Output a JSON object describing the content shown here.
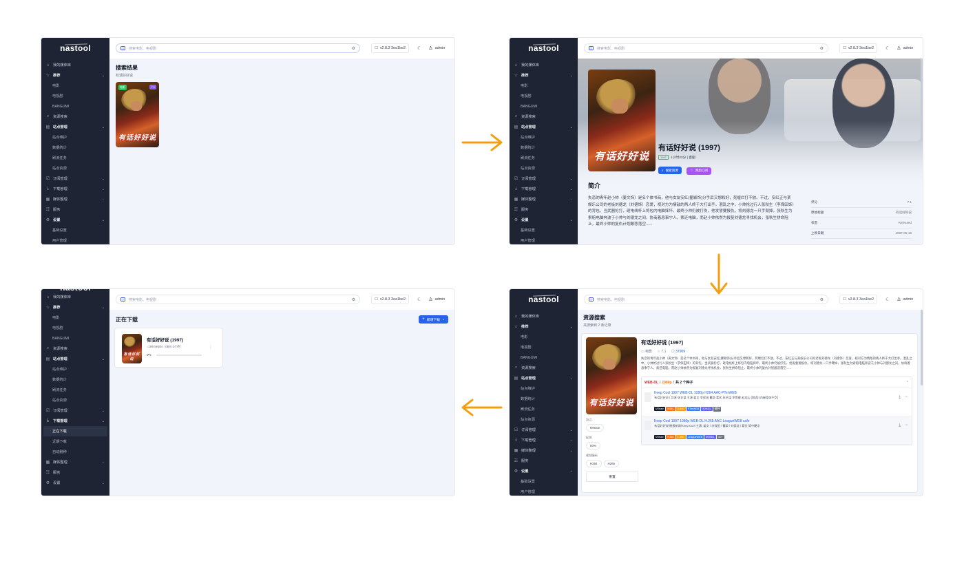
{
  "app": {
    "logo": "nastool",
    "search_placeholder": "搜索电影、电视剧",
    "version": "v2.8.3 3ea1be2",
    "user": "admin"
  },
  "sidebar": {
    "p1": [
      "我的媒体库",
      "推荐",
      "电影",
      "电视剧",
      "BANGUMI",
      "资源搜索",
      "站点管理",
      "站点维护",
      "数据统计",
      "刷流任务",
      "站点资源",
      "订阅管理",
      "下载管理",
      "媒体整理",
      "服务",
      "设置",
      "基础设置",
      "用户管理"
    ],
    "p3": [
      "我的媒体库",
      "推荐",
      "电影",
      "电视剧",
      "BANGUMI",
      "资源搜索",
      "站点管理",
      "站点维护",
      "数据统计",
      "刷流任务",
      "站点资源",
      "订阅管理",
      "下载管理",
      "媒体整理",
      "服务",
      "设置",
      "基础设置",
      "用户管理"
    ],
    "p4": [
      "我的媒体库",
      "推荐",
      "电影",
      "电视剧",
      "BANGUMI",
      "资源搜索",
      "站点管理",
      "站点维护",
      "数据统计",
      "刷流任务",
      "站点资源",
      "订阅管理",
      "下载管理",
      "正在下载",
      "近期下载",
      "自动删种",
      "媒体整理",
      "服务",
      "设置"
    ]
  },
  "search_results": {
    "title": "搜索结果",
    "subtitle": "有话好好说",
    "poster_title": "有话好好说",
    "badge_left": "电影",
    "badge_right": "7.1"
  },
  "detail": {
    "title": "有话好好说 (1997)",
    "meta_badge": "1997",
    "meta": "1小时33分 | 喜剧",
    "btn_search": "搜索资源",
    "btn_subscribe": "添加订阅",
    "section": "简介",
    "overview": "失恋的青年赵小帅（姜文饰）是名个体书商，他与女友安红(瞿颖饰)分手后又想和好，死缠烂打不放。不过，安红正与某娱乐公司的老板刘德龙（刘德饰）恋爱，视对方为情敌的两人终于大打出手。混乱之中，小帅抢过行人张秋生（李保田饰）的背包，当武器抡打，砸电线杆上将包内电脑摔坏。最终小帅仍被打伤，他发誓要报仇，将刘德龙一只手臂掉，张秋生为索赔电脑奔波于小帅与刘德龙之间，协商着息事宁人，索还电脑，而赵小帅依然为报复刘德龙寻找机会，张秋生拼命阻止，最终小帅的复仇计划酿悲落空......",
    "facts": [
      {
        "k": "评分",
        "v": "7.1"
      },
      {
        "k": "原始标题",
        "v": "有话好好说"
      },
      {
        "k": "状态",
        "v": "Released"
      },
      {
        "k": "上映日期",
        "v": "1997-05-16"
      }
    ]
  },
  "resources": {
    "title": "资源搜索",
    "subtitle": "共搜索到 2 条记录",
    "item_title": "有话好好说 (1997)",
    "type": "电影",
    "score": "7.1",
    "id": "37909",
    "overview": "失恋的青年赵小帅（姜文饰）是名个体书商，他与女友安红(瞿颖饰)分手后又想和好，死缠烂打不放。不过，安红正与某娱乐公司的老板刘德龙（刘德饰）恋爱，视对方为情敌的两人终于大打出手。混乱之中，小帅抢过行人张秋生（李保田饰）的背包，当武器抡打，砸电线杆上将包内电脑摔坏，最终小帅仍被打伤，他发誓要报仇，将刘德龙一只手臂掉，张秋生为索赔电脑奔波于小帅与刘德龙之间，协商着息事宁人，索还电脑，而赵小帅依然为报复刘德龙寻找机会，张秋生拼命阻止，最终小帅的复仇计划酿悲落空......",
    "group_label_a": "WEB-DL",
    "group_label_b": "1080p",
    "group_label_c": "共 2 个种子",
    "filters": {
      "site_label": "站点",
      "site_value": "MTeam",
      "promo_label": "促销",
      "promo_value": "50%",
      "codec_label": "视频编码",
      "codec_a": "H264",
      "codec_b": "H265",
      "reset": "重置"
    },
    "torrents": [
      {
        "name": "Keep Cool 1997 WEB-DL 1080p H264 AAC-PTerWEB",
        "desc": "有话好好说 | 导演 张艺谋 主演 姜文 李保田 瞿颖 葛优 张艺谋 李雪健 赵本山 [国语] [内嵌简体中字]",
        "tags": [
          {
            "t": "MTeam",
            "c": "#111827"
          },
          {
            "t": "H264",
            "c": "#f97316"
          },
          {
            "t": "3.84G",
            "c": "#f59e0b"
          },
          {
            "t": "PTerWEB",
            "c": "#3b82f6"
          },
          {
            "t": "50%DL",
            "c": "#6366f1"
          },
          {
            "t": "做种",
            "c": "#6b7280"
          }
        ]
      },
      {
        "name": "Keep Cool 1997 1080p WEB-DL H.265 AAC-LeagueWEB cafe",
        "desc": "有话好好说/晚报新闻/Keep Cool 主演: 姜文 / 李保田 / 瞿颖 / 刘德龙 / 葛优 简中硬字",
        "tags": [
          {
            "t": "MTeam",
            "c": "#111827"
          },
          {
            "t": "H265",
            "c": "#f97316"
          },
          {
            "t": "1.39G",
            "c": "#f59e0b"
          },
          {
            "t": "LeagueWEB",
            "c": "#3b82f6"
          },
          {
            "t": "50%DL",
            "c": "#6366f1"
          },
          {
            "t": "3DT",
            "c": "#6b7280"
          }
        ]
      }
    ]
  },
  "downloading": {
    "title": "正在下载",
    "new_button": "新增下载",
    "item_title": "有话好好说 (1997)",
    "speed": "↓199.5KB/s ↑0B/s 3小时",
    "progress": 0,
    "progress_text": "0%"
  },
  "colors": {
    "sidebar": "#1e2433",
    "accent": "#2563eb",
    "arrow": "#f59e0b",
    "purple": "#a855f7"
  }
}
